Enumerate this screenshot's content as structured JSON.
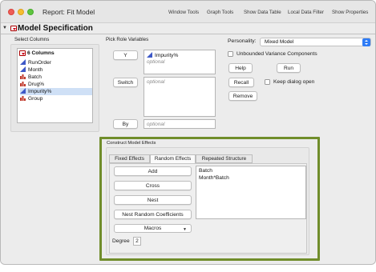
{
  "window": {
    "title": "Report: Fit Model",
    "toolbar": [
      "Window Tools",
      "Graph Tools",
      "Show Data Table",
      "Local Data Filter",
      "Show Properties"
    ]
  },
  "section": {
    "title": "Model Specification"
  },
  "select_columns": {
    "label": "Select Columns",
    "count_label": "6 Columns",
    "items": [
      {
        "name": "RunOrder",
        "icon": "continuous-icon",
        "selected": false
      },
      {
        "name": "Month",
        "icon": "continuous-icon",
        "selected": false
      },
      {
        "name": "Batch",
        "icon": "nominal-icon",
        "selected": false
      },
      {
        "name": "Drug%",
        "icon": "nominal-icon",
        "selected": false
      },
      {
        "name": "Impurity%",
        "icon": "continuous-icon",
        "selected": true
      },
      {
        "name": "Group",
        "icon": "nominal-icon",
        "selected": false
      }
    ]
  },
  "roles": {
    "label": "Pick Role Variables",
    "y_button": "Y",
    "y_value": "Impurity%",
    "y_hint": "optional",
    "switch_button": "Switch",
    "switch_hint": "optional",
    "by_button": "By",
    "by_hint": "optional"
  },
  "personality": {
    "label": "Personality:",
    "value": "Mixed Model",
    "unbounded_label": "Unbounded Variance Components",
    "help": "Help",
    "run": "Run",
    "recall": "Recall",
    "keep_open_label": "Keep dialog open",
    "remove": "Remove"
  },
  "effects": {
    "label": "Construct Model Effects",
    "tabs": [
      "Fixed Effects",
      "Random Effects",
      "Repeated Structure"
    ],
    "active_tab": "Random Effects",
    "add": "Add",
    "cross": "Cross",
    "nest": "Nest",
    "nest_random": "Nest Random Coefficients",
    "macros": "Macros",
    "degree_label": "Degree",
    "degree_value": "2",
    "items": [
      "Batch",
      "Month*Batch"
    ]
  },
  "colors": {
    "highlight_border": "#708d2b",
    "selection": "#cfe0f6",
    "popup_accent": "#2f7cf6",
    "red_triangle": "#d0021b"
  }
}
